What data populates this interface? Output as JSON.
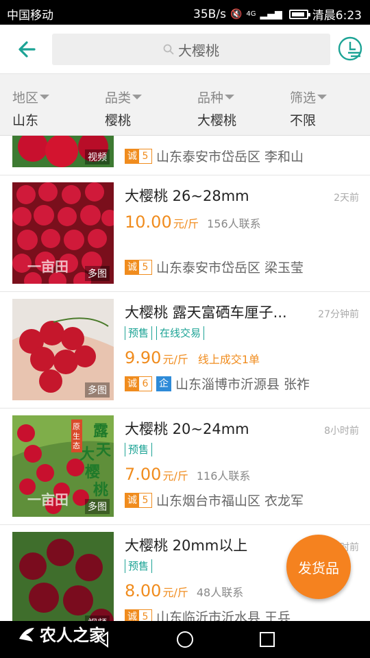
{
  "status_bar": {
    "carrier": "中国移动",
    "speed": "35B/s",
    "network": "4G",
    "time": "清晨6:23"
  },
  "header": {
    "search_text": "大樱桃"
  },
  "filters": [
    {
      "label": "地区",
      "value": "山东"
    },
    {
      "label": "品类",
      "value": "樱桃"
    },
    {
      "label": "品种",
      "value": "大樱桃"
    },
    {
      "label": "筛选",
      "value": "不限"
    }
  ],
  "listings": [
    {
      "media": "视频",
      "cheng_label": "诚",
      "cheng_level": "5",
      "location": "山东泰安市岱岳区 李和山"
    },
    {
      "title": "大樱桃 26~28mm",
      "time": "2天前",
      "price": "10.00",
      "unit": "元/斤",
      "contacts": "156人联系",
      "media": "多图",
      "watermark": "一亩田",
      "cheng_label": "诚",
      "cheng_level": "5",
      "location": "山东泰安市岱岳区 梁玉莹"
    },
    {
      "title": "大樱桃 露天富硒车厘子...",
      "time": "27分钟前",
      "tags": [
        "预售",
        "在线交易"
      ],
      "price": "9.90",
      "unit": "元/斤",
      "deal": "线上成交1单",
      "media": "多图",
      "cheng_label": "诚",
      "cheng_level": "6",
      "qi_label": "企",
      "location": "山东淄博市沂源县 张祚"
    },
    {
      "title": "大樱桃 20~24mm",
      "time": "8小时前",
      "tags": [
        "预售"
      ],
      "price": "7.00",
      "unit": "元/斤",
      "contacts": "116人联系",
      "media": "多图",
      "image_text": "露天大樱桃",
      "image_badge": "原生态",
      "watermark": "一亩田",
      "cheng_label": "诚",
      "cheng_level": "5",
      "location": "山东烟台市福山区 衣龙军"
    },
    {
      "title": "大樱桃 20mm以上",
      "time": "时前",
      "tags": [
        "预售"
      ],
      "price": "8.00",
      "unit": "元/斤",
      "contacts": "48人联系",
      "media": "视频",
      "cheng_label": "诚",
      "cheng_level": "5",
      "location": "山东临沂市沂水县 王兵"
    }
  ],
  "fab_label": "发货品",
  "brand": "农人之家",
  "colors": {
    "accent": "#1ca395",
    "price": "#f08c1e",
    "fab": "#f5821f"
  }
}
